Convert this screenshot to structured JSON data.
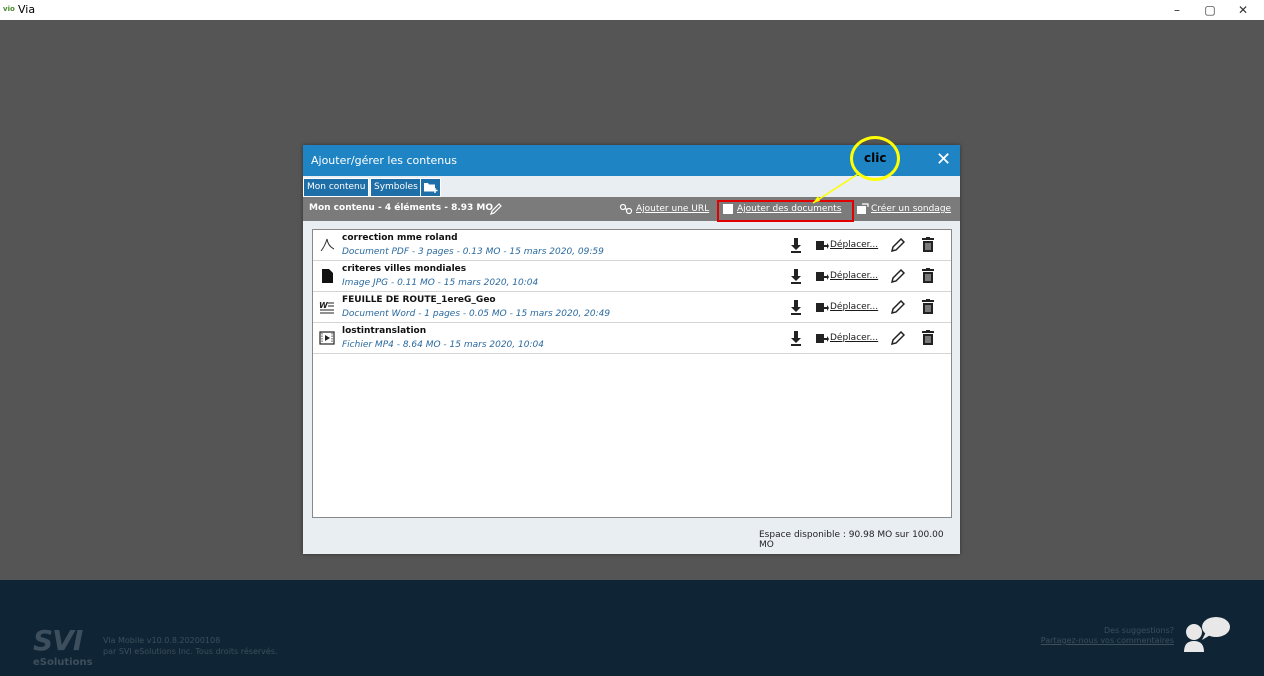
{
  "window": {
    "app_logo": "vio",
    "title": "Via",
    "minimize": "–",
    "maximize": "▢",
    "close": "✕"
  },
  "dialog": {
    "title": "Ajouter/gérer les contenus",
    "close": "✕",
    "tabs": [
      {
        "label": "Mon contenu"
      },
      {
        "label": "Symboles"
      }
    ],
    "toolbar": {
      "summary": "Mon contenu - 4 éléments - 8.93 MO",
      "add_url": "Ajouter une URL",
      "add_documents": "Ajouter des documents",
      "create_poll": "Créer un sondage"
    },
    "items": [
      {
        "name": "correction mme roland",
        "meta": "Document PDF - 3 pages - 0.13 MO - 15 mars 2020, 09:59",
        "icon": "pdf-icon",
        "move": "Déplacer..."
      },
      {
        "name": "criteres villes mondiales",
        "meta": "Image JPG - 0.11 MO - 15 mars 2020, 10:04",
        "icon": "image-icon",
        "move": "Déplacer..."
      },
      {
        "name": "FEUILLE DE ROUTE_1ereG_Geo",
        "meta": "Document Word - 1 pages - 0.05 MO - 15 mars 2020, 20:49",
        "icon": "word-icon",
        "move": "Déplacer..."
      },
      {
        "name": "lostintranslation",
        "meta": "Fichier MP4 - 8.64 MO - 15 mars 2020, 10:04",
        "icon": "video-icon",
        "move": "Déplacer..."
      }
    ],
    "space": "Espace disponible : 90.98 MO sur 100.00 MO"
  },
  "annotation": {
    "label": "clic",
    "color": "#ffff00"
  },
  "footer": {
    "logo_big": "SVI",
    "logo_small": "eSolutions",
    "version_line1": "Via Mobile v10.0.8.20200108",
    "version_line2": "par SVI eSolutions Inc. Tous droits réservés.",
    "suggest_line1": "Des suggestions?",
    "suggest_line2": "Partagez-nous vos commentaires"
  },
  "colors": {
    "header_blue": "#1e84c4",
    "toolbar_gray": "#7b7b7b",
    "footer_navy": "#0f2434",
    "highlight_red": "#e00000"
  }
}
